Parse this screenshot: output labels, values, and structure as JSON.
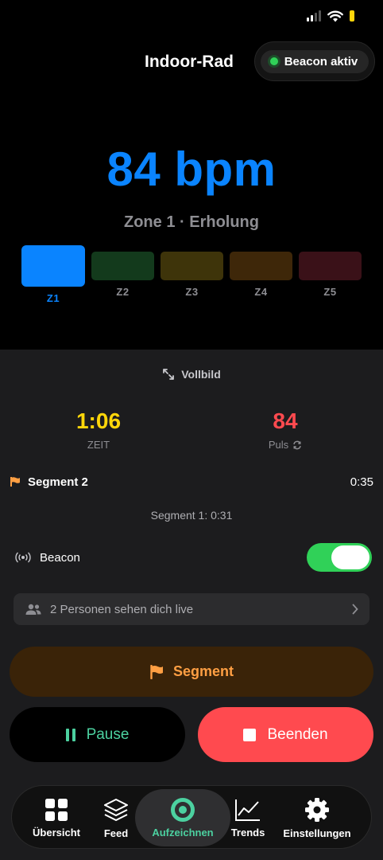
{
  "header": {
    "title": "Indoor-Rad",
    "beacon_status": "Beacon aktiv"
  },
  "heart_rate": {
    "display": "84 bpm",
    "zone_label": "Zone 1 · Erholung"
  },
  "zones": [
    {
      "label": "Z1",
      "color": "#0a84ff",
      "active": true
    },
    {
      "label": "Z2",
      "color": "#133a1c",
      "active": false
    },
    {
      "label": "Z3",
      "color": "#3e340a",
      "active": false
    },
    {
      "label": "Z4",
      "color": "#3e2709",
      "active": false
    },
    {
      "label": "Z5",
      "color": "#3a1118",
      "active": false
    }
  ],
  "panel": {
    "fullscreen_label": "Vollbild",
    "time": {
      "value": "1:06",
      "label": "ZEIT",
      "color": "#ffd60a"
    },
    "pulse": {
      "value": "84",
      "label": "Puls",
      "color": "#ff4a4f"
    },
    "current_segment": {
      "label": "Segment 2",
      "time": "0:35"
    },
    "previous_segment": "Segment 1: 0:31",
    "beacon": {
      "label": "Beacon",
      "enabled": true
    },
    "viewers_text": "2 Personen sehen dich live"
  },
  "buttons": {
    "segment": "Segment",
    "pause": "Pause",
    "end": "Beenden"
  },
  "tabs": [
    {
      "label": "Übersicht",
      "icon": "grid-icon",
      "active": false
    },
    {
      "label": "Feed",
      "icon": "layers-icon",
      "active": false
    },
    {
      "label": "Aufzeichnen",
      "icon": "record-icon",
      "active": true
    },
    {
      "label": "Trends",
      "icon": "chart-icon",
      "active": false
    },
    {
      "label": "Einstellungen",
      "icon": "gear-icon",
      "active": false
    }
  ],
  "colors": {
    "accent_blue": "#0a84ff",
    "accent_green": "#30d158",
    "accent_orange": "#ff9f43",
    "accent_red": "#ff4a4f",
    "accent_teal": "#4cd1a0"
  }
}
